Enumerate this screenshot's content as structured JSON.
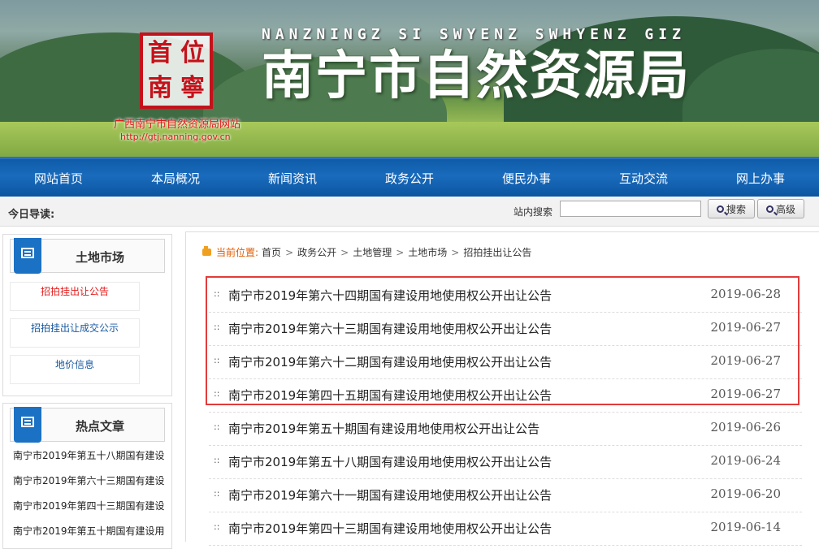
{
  "banner": {
    "pinyin": "NANZNINGZ SI SWYENZ SWHYENZ GIZ",
    "title": "南宁市自然资源局",
    "seal_chars": [
      "首",
      "位",
      "南",
      "寧"
    ],
    "site_name": "广西南宁市自然资源局网站",
    "site_url": "http://gtj.nanning.gov.cn"
  },
  "nav": {
    "items": [
      "网站首页",
      "本局概况",
      "新闻资讯",
      "政务公开",
      "便民办事",
      "互动交流",
      "网上办事"
    ]
  },
  "topbar": {
    "today_label": "今日导读:",
    "search_label": "站内搜索",
    "search_value": "",
    "search_button": "搜索",
    "advanced_button": "高级"
  },
  "sidebar": {
    "panel1": {
      "title": "土地市场",
      "links": [
        "招拍挂出让公告",
        "招拍挂出让成交公示",
        "地价信息"
      ]
    },
    "panel2": {
      "title": "热点文章",
      "items": [
        "南宁市2019年第五十八期国有建设",
        "南宁市2019年第六十三期国有建设",
        "南宁市2019年第四十三期国有建设",
        "南宁市2019年第五十期国有建设用"
      ]
    }
  },
  "breadcrumb": {
    "label": "当前位置:",
    "items": [
      "首页",
      "政务公开",
      "土地管理",
      "土地市场",
      "招拍挂出让公告"
    ]
  },
  "articles": [
    {
      "title": "南宁市2019年第六十四期国有建设用地使用权公开出让公告",
      "date": "2019-06-28"
    },
    {
      "title": "南宁市2019年第六十三期国有建设用地使用权公开出让公告",
      "date": "2019-06-27"
    },
    {
      "title": "南宁市2019年第六十二期国有建设用地使用权公开出让公告",
      "date": "2019-06-27"
    },
    {
      "title": "南宁市2019年第四十五期国有建设用地使用权公开出让公告",
      "date": "2019-06-27"
    },
    {
      "title": "南宁市2019年第五十期国有建设用地使用权公开出让公告",
      "date": "2019-06-26"
    },
    {
      "title": "南宁市2019年第五十八期国有建设用地使用权公开出让公告",
      "date": "2019-06-24"
    },
    {
      "title": "南宁市2019年第六十一期国有建设用地使用权公开出让公告",
      "date": "2019-06-20"
    },
    {
      "title": "南宁市2019年第四十三期国有建设用地使用权公开出让公告",
      "date": "2019-06-14"
    }
  ],
  "bullet": "::",
  "colors": {
    "nav_blue": "#0e5ca8",
    "highlight_red": "#e23b3b",
    "active_link": "#e31b1b"
  }
}
